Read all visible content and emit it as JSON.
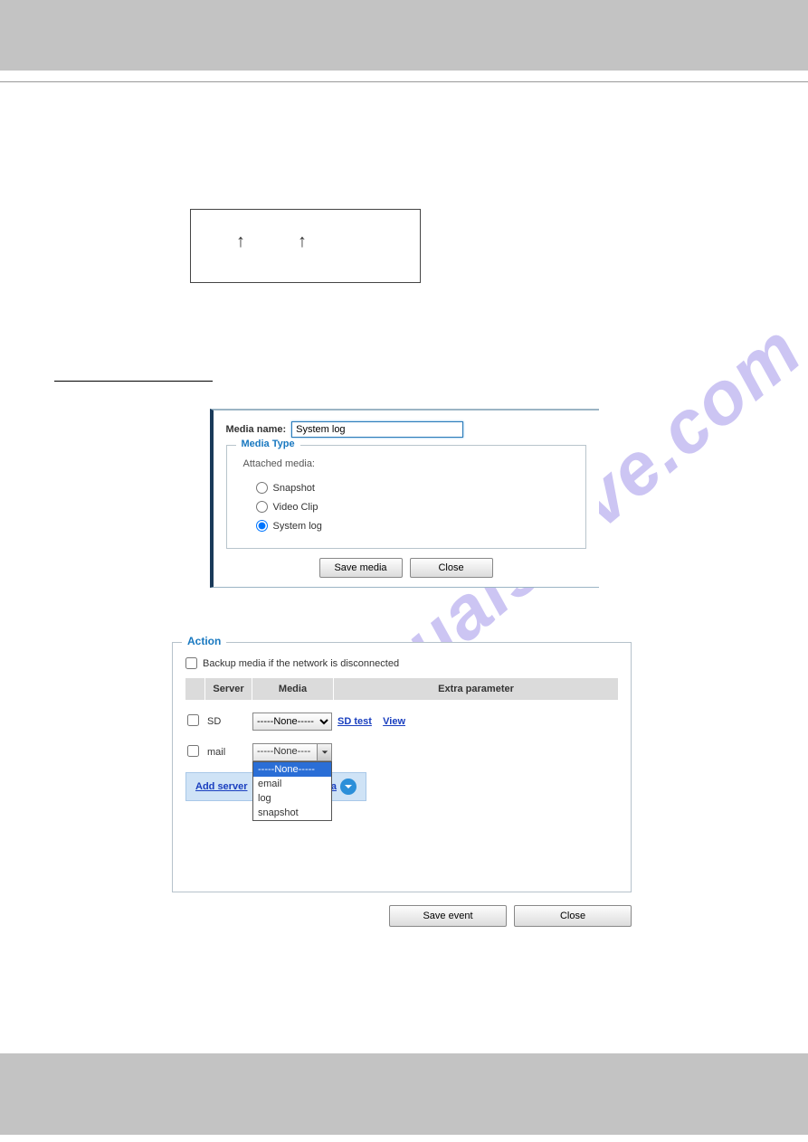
{
  "watermark": "manualshive.com",
  "media_shot": {
    "name_label": "Media name:",
    "name_value": "System log",
    "media_type_legend": "Media Type",
    "attached_label": "Attached media:",
    "options": {
      "snapshot": "Snapshot",
      "video": "Video Clip",
      "systemlog": "System log"
    },
    "selected": "systemlog",
    "save_btn": "Save media",
    "close_btn": "Close"
  },
  "action_shot": {
    "legend": "Action",
    "backup_label": "Backup media if the network is disconnected",
    "columns": {
      "server": "Server",
      "media": "Media",
      "extra": "Extra parameter"
    },
    "rows": [
      {
        "server": "SD",
        "media_value": "-----None-----",
        "links": [
          "SD test",
          "View"
        ]
      },
      {
        "server": "mail",
        "media_value": "-----None-----",
        "dropdown_open": true,
        "options": [
          "-----None-----",
          "email",
          "log",
          "snapshot"
        ]
      }
    ],
    "add_server": "Add server",
    "add_media_suffix": "dia",
    "save_event": "Save event",
    "close": "Close"
  }
}
